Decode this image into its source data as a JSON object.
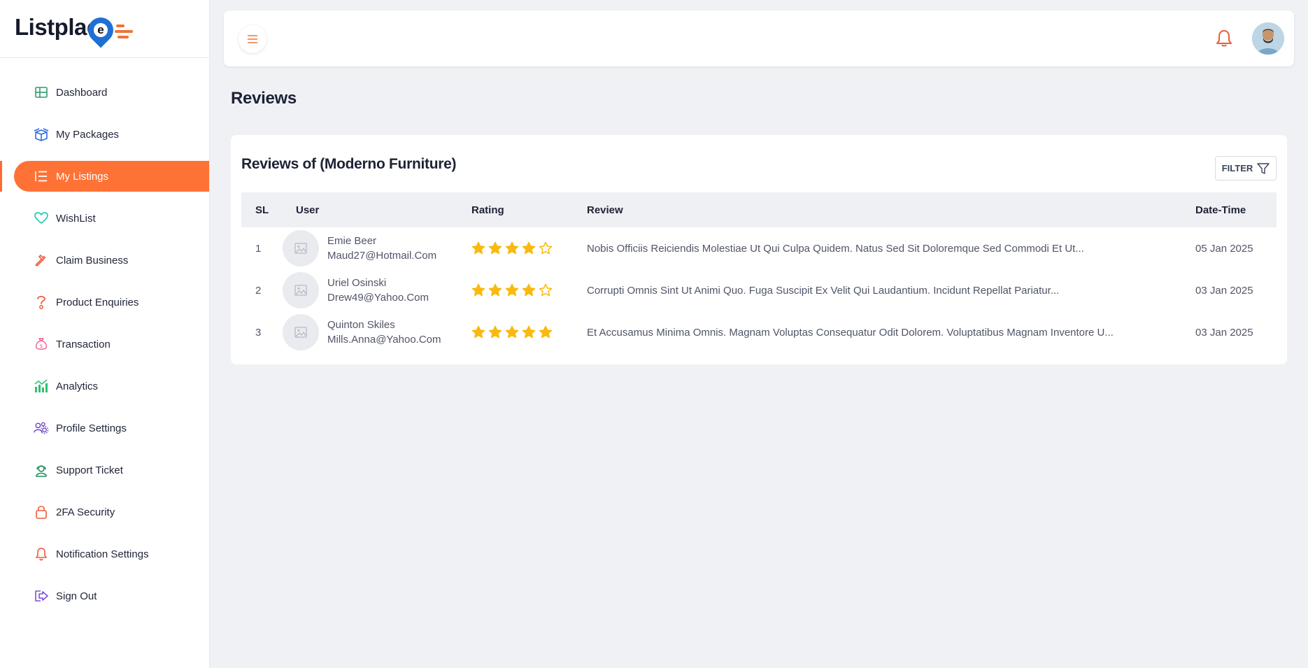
{
  "brand": {
    "logo_text": "Listplac",
    "logo_letter": "e"
  },
  "sidebar": {
    "items": [
      {
        "label": "Dashboard",
        "icon": "dashboard-icon",
        "color": "#2a9d6a"
      },
      {
        "label": "My Packages",
        "icon": "package-icon",
        "color": "#2f6de0"
      },
      {
        "label": "My Listings",
        "icon": "listings-icon",
        "color": "#ffffff",
        "active": true
      },
      {
        "label": "WishList",
        "icon": "heart-icon",
        "color": "#1fc8b5"
      },
      {
        "label": "Claim Business",
        "icon": "hammer-icon",
        "color": "#f05a3a"
      },
      {
        "label": "Product Enquiries",
        "icon": "question-icon",
        "color": "#f05a3a"
      },
      {
        "label": "Transaction",
        "icon": "money-bag-icon",
        "color": "#ef5b8e"
      },
      {
        "label": "Analytics",
        "icon": "analytics-icon",
        "color": "#2fbf71"
      },
      {
        "label": "Profile Settings",
        "icon": "profile-settings-icon",
        "color": "#6a3fc6"
      },
      {
        "label": "Support Ticket",
        "icon": "support-icon",
        "color": "#1f8f5a"
      },
      {
        "label": "2FA Security",
        "icon": "lock-icon",
        "color": "#f05a3a"
      },
      {
        "label": "Notification Settings",
        "icon": "bell-icon",
        "color": "#f05a3a"
      },
      {
        "label": "Sign Out",
        "icon": "sign-out-icon",
        "color": "#7b4fd6"
      }
    ]
  },
  "page": {
    "title": "Reviews"
  },
  "card": {
    "title": "Reviews of (Moderno Furniture)",
    "filter_label": "FILTER"
  },
  "table": {
    "headers": {
      "sl": "SL",
      "user": "User",
      "rating": "Rating",
      "review": "Review",
      "date": "Date-Time"
    },
    "rows": [
      {
        "sl": "1",
        "name": "Emie Beer",
        "email": "Maud27@Hotmail.Com",
        "rating": 4,
        "review": "Nobis Officiis Reiciendis Molestiae Ut Qui Culpa Quidem. Natus Sed Sit Doloremque Sed Commodi Et Ut...",
        "date": "05 Jan 2025"
      },
      {
        "sl": "2",
        "name": "Uriel Osinski",
        "email": "Drew49@Yahoo.Com",
        "rating": 4,
        "review": "Corrupti Omnis Sint Ut Animi Quo. Fuga Suscipit Ex Velit Qui Laudantium. Incidunt Repellat Pariatur...",
        "date": "03 Jan 2025"
      },
      {
        "sl": "3",
        "name": "Quinton Skiles",
        "email": "Mills.Anna@Yahoo.Com",
        "rating": 5,
        "review": "Et Accusamus Minima Omnis. Magnam Voluptas Consequatur Odit Dolorem. Voluptatibus Magnam Inventore U...",
        "date": "03 Jan 2025"
      }
    ]
  },
  "colors": {
    "accent": "#ff7235",
    "star": "#f9b90f"
  }
}
